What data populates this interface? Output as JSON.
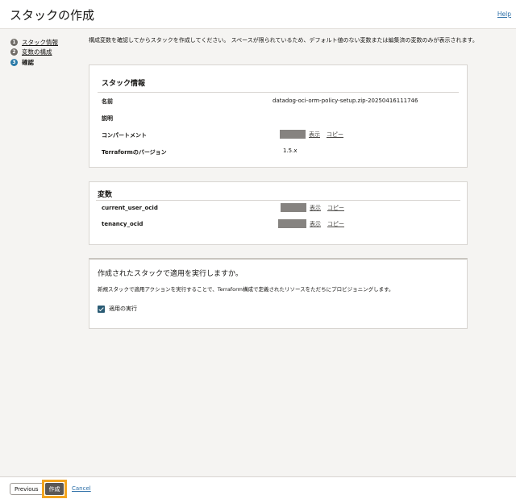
{
  "header": {
    "title": "スタックの作成",
    "help": "Help"
  },
  "steps": [
    {
      "num": "1",
      "label": "スタック情報"
    },
    {
      "num": "2",
      "label": "変数の構成"
    },
    {
      "num": "3",
      "label": "確認"
    }
  ],
  "intro": "構成変数を確認してからスタックを作成してください。 スペースが限られているため、デフォルト値のない変数または編集済の変数のみが表示されます。",
  "stack_info": {
    "heading": "スタック情報",
    "name_label": "名前",
    "name_value": "datadog-oci-orm-policy-setup.zip-20250416111746",
    "desc_label": "説明",
    "compartment_label": "コンパートメント",
    "tf_label": "Terraformのバージョン",
    "tf_value": "1.5.x",
    "show": "表示",
    "copy": "コピー"
  },
  "variables": {
    "heading": "変数",
    "items": [
      {
        "label": "current_user_ocid"
      },
      {
        "label": "tenancy_ocid"
      }
    ],
    "show": "表示",
    "copy": "コピー"
  },
  "apply": {
    "heading": "作成されたスタックで適用を実行しますか。",
    "desc": "新規スタックで適用アクションを実行することで、Terraform構成で定義されたリソースをただちにプロビジョニングします。",
    "checkbox_label": "適用の実行"
  },
  "footer": {
    "previous": "Previous",
    "create": "作成",
    "cancel": "Cancel"
  }
}
